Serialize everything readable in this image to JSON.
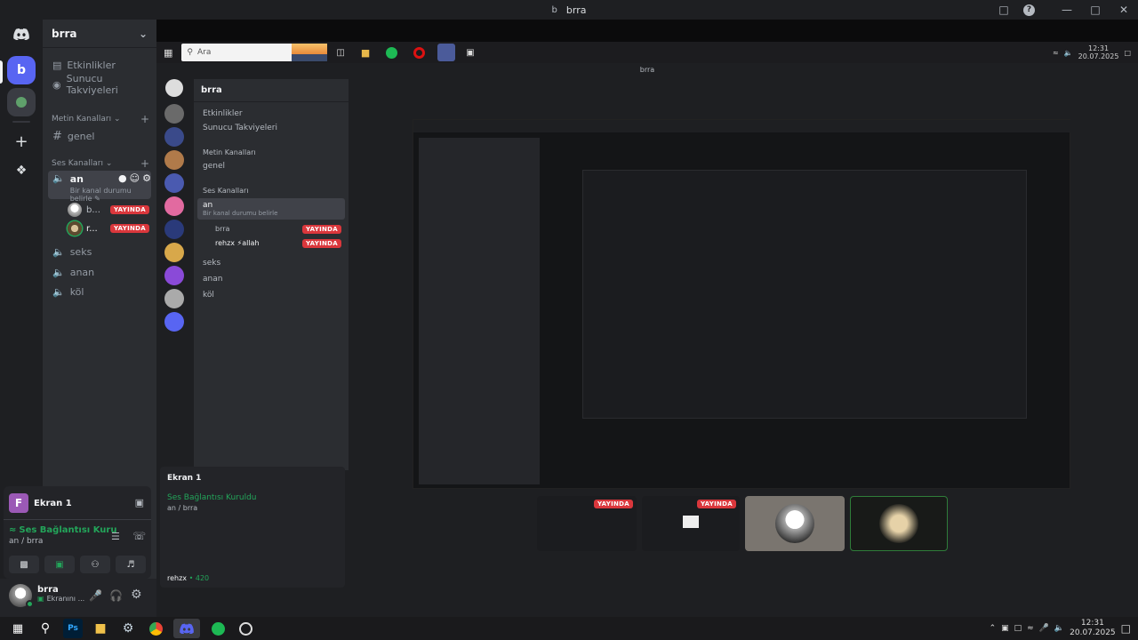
{
  "window": {
    "title": "brra",
    "avatar_letter": "b"
  },
  "server": {
    "name": "brra"
  },
  "sidebar": {
    "events_label": "Etkinlikler",
    "boosts_label": "Sunucu Takviyeleri",
    "text_category": "Metin Kanalları",
    "text_channels": [
      "genel"
    ],
    "voice_category": "Ses Kanalları",
    "active_voice": {
      "name": "an",
      "status": "Bir kanal durumu belirle"
    },
    "voice_users": [
      {
        "name": "b...",
        "badge": "YAYINDA"
      },
      {
        "name": "r...",
        "badge": "YAYINDA"
      }
    ],
    "voice_channels": [
      "seks",
      "anan",
      "köl"
    ]
  },
  "voice_panel": {
    "stream_label": "Ekran 1",
    "stream_letter": "F",
    "connection_status": "Ses Bağlantısı Kuru",
    "channel_path": "an / brra"
  },
  "user_panel": {
    "name": "brra",
    "status": "Ekranını ..."
  },
  "nested": {
    "search_placeholder": "Ara",
    "title": "brra",
    "server_name": "brra",
    "events_label": "Etkinlikler",
    "boosts_label": "Sunucu Takviyeleri",
    "text_category": "Metin Kanalları",
    "text_channel": "genel",
    "voice_category": "Ses Kanalları",
    "active_voice": "an",
    "active_status": "Bir kanal durumu belirle",
    "user1": "brra",
    "user2": "rehzx ⚡allah",
    "badge": "YAYINDA",
    "voice_channels": [
      "seks",
      "anan",
      "köl"
    ],
    "stream_label": "Ekran 1",
    "connection_status": "Ses Bağlantısı Kuruldu",
    "channel_path": "an / brra",
    "user_name": "rehzx",
    "user_status": "• 420",
    "clock_time": "12:31",
    "clock_date": "20.07.2025"
  },
  "tiles": [
    {
      "badge": "YAYINDA"
    },
    {
      "badge": "YAYINDA"
    },
    {
      "badge": ""
    },
    {
      "badge": ""
    }
  ],
  "taskbar": {
    "apps": [
      "start-icon",
      "search-icon",
      "photoshop-icon",
      "file-explorer-icon",
      "steam-icon",
      "chrome-icon",
      "discord-icon",
      "spotify-icon",
      "obs-icon"
    ],
    "ps_label": "Ps",
    "time": "12:31",
    "date": "20.07.2025"
  },
  "colors": {
    "accent": "#5865f2",
    "live": "#da373c",
    "connected": "#23a55a"
  }
}
